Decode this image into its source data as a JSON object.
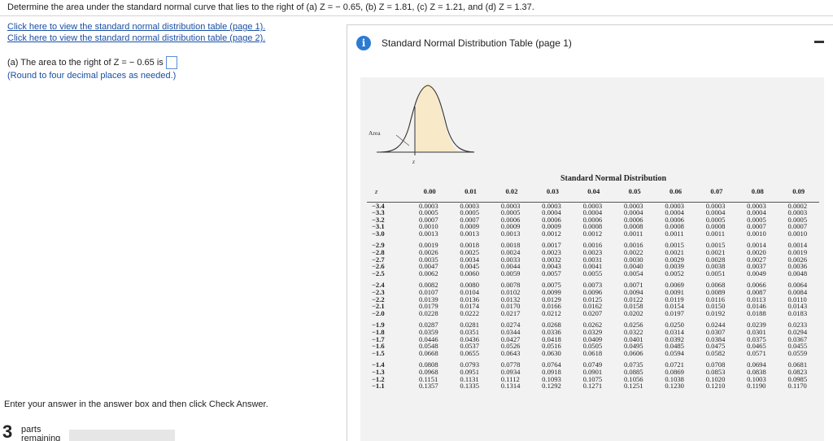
{
  "question": "Determine the area under the standard normal curve that lies to the right of (a) Z = − 0.65, (b) Z = 1.81, (c) Z = 1.21, and (d) Z = 1.37.",
  "links": {
    "page1": "Click here to view the standard normal distribution table (page 1).",
    "page2": "Click here to view the standard normal distribution table (page 2)."
  },
  "part_a": {
    "label": "(a) The area to the right of Z = − 0.65 is",
    "value": "",
    "note": "(Round to four decimal places as needed.)"
  },
  "footer": {
    "instruction": "Enter your answer in the answer box and then click Check Answer.",
    "parts_count": "3",
    "parts_label_1": "parts",
    "parts_label_2": "remaining",
    "progress_fraction": 0.0,
    "accent_color": "#5b8ed6"
  },
  "panel": {
    "title": "Standard Normal Distribution Table (page 1)",
    "icon": "info-icon",
    "curve_labels": {
      "area": "Area",
      "z": "z"
    },
    "table_title": "Standard Normal Distribution",
    "z_header": "z",
    "columns": [
      "0.00",
      "0.01",
      "0.02",
      "0.03",
      "0.04",
      "0.05",
      "0.06",
      "0.07",
      "0.08",
      "0.09"
    ],
    "groups": [
      [
        {
          "z": "−3.4",
          "v": [
            "0.0003",
            "0.0003",
            "0.0003",
            "0.0003",
            "0.0003",
            "0.0003",
            "0.0003",
            "0.0003",
            "0.0003",
            "0.0002"
          ]
        },
        {
          "z": "−3.3",
          "v": [
            "0.0005",
            "0.0005",
            "0.0005",
            "0.0004",
            "0.0004",
            "0.0004",
            "0.0004",
            "0.0004",
            "0.0004",
            "0.0003"
          ]
        },
        {
          "z": "−3.2",
          "v": [
            "0.0007",
            "0.0007",
            "0.0006",
            "0.0006",
            "0.0006",
            "0.0006",
            "0.0006",
            "0.0005",
            "0.0005",
            "0.0005"
          ]
        },
        {
          "z": "−3.1",
          "v": [
            "0.0010",
            "0.0009",
            "0.0009",
            "0.0009",
            "0.0008",
            "0.0008",
            "0.0008",
            "0.0008",
            "0.0007",
            "0.0007"
          ]
        },
        {
          "z": "−3.0",
          "v": [
            "0.0013",
            "0.0013",
            "0.0013",
            "0.0012",
            "0.0012",
            "0.0011",
            "0.0011",
            "0.0011",
            "0.0010",
            "0.0010"
          ]
        }
      ],
      [
        {
          "z": "−2.9",
          "v": [
            "0.0019",
            "0.0018",
            "0.0018",
            "0.0017",
            "0.0016",
            "0.0016",
            "0.0015",
            "0.0015",
            "0.0014",
            "0.0014"
          ]
        },
        {
          "z": "−2.8",
          "v": [
            "0.0026",
            "0.0025",
            "0.0024",
            "0.0023",
            "0.0023",
            "0.0022",
            "0.0021",
            "0.0021",
            "0.0020",
            "0.0019"
          ]
        },
        {
          "z": "−2.7",
          "v": [
            "0.0035",
            "0.0034",
            "0.0033",
            "0.0032",
            "0.0031",
            "0.0030",
            "0.0029",
            "0.0028",
            "0.0027",
            "0.0026"
          ]
        },
        {
          "z": "−2.6",
          "v": [
            "0.0047",
            "0.0045",
            "0.0044",
            "0.0043",
            "0.0041",
            "0.0040",
            "0.0039",
            "0.0038",
            "0.0037",
            "0.0036"
          ]
        },
        {
          "z": "−2.5",
          "v": [
            "0.0062",
            "0.0060",
            "0.0059",
            "0.0057",
            "0.0055",
            "0.0054",
            "0.0052",
            "0.0051",
            "0.0049",
            "0.0048"
          ]
        }
      ],
      [
        {
          "z": "−2.4",
          "v": [
            "0.0082",
            "0.0080",
            "0.0078",
            "0.0075",
            "0.0073",
            "0.0071",
            "0.0069",
            "0.0068",
            "0.0066",
            "0.0064"
          ]
        },
        {
          "z": "−2.3",
          "v": [
            "0.0107",
            "0.0104",
            "0.0102",
            "0.0099",
            "0.0096",
            "0.0094",
            "0.0091",
            "0.0089",
            "0.0087",
            "0.0084"
          ]
        },
        {
          "z": "−2.2",
          "v": [
            "0.0139",
            "0.0136",
            "0.0132",
            "0.0129",
            "0.0125",
            "0.0122",
            "0.0119",
            "0.0116",
            "0.0113",
            "0.0110"
          ]
        },
        {
          "z": "−2.1",
          "v": [
            "0.0179",
            "0.0174",
            "0.0170",
            "0.0166",
            "0.0162",
            "0.0158",
            "0.0154",
            "0.0150",
            "0.0146",
            "0.0143"
          ]
        },
        {
          "z": "−2.0",
          "v": [
            "0.0228",
            "0.0222",
            "0.0217",
            "0.0212",
            "0.0207",
            "0.0202",
            "0.0197",
            "0.0192",
            "0.0188",
            "0.0183"
          ]
        }
      ],
      [
        {
          "z": "−1.9",
          "v": [
            "0.0287",
            "0.0281",
            "0.0274",
            "0.0268",
            "0.0262",
            "0.0256",
            "0.0250",
            "0.0244",
            "0.0239",
            "0.0233"
          ]
        },
        {
          "z": "−1.8",
          "v": [
            "0.0359",
            "0.0351",
            "0.0344",
            "0.0336",
            "0.0329",
            "0.0322",
            "0.0314",
            "0.0307",
            "0.0301",
            "0.0294"
          ]
        },
        {
          "z": "−1.7",
          "v": [
            "0.0446",
            "0.0436",
            "0.0427",
            "0.0418",
            "0.0409",
            "0.0401",
            "0.0392",
            "0.0384",
            "0.0375",
            "0.0367"
          ]
        },
        {
          "z": "−1.6",
          "v": [
            "0.0548",
            "0.0537",
            "0.0526",
            "0.0516",
            "0.0505",
            "0.0495",
            "0.0485",
            "0.0475",
            "0.0465",
            "0.0455"
          ]
        },
        {
          "z": "−1.5",
          "v": [
            "0.0668",
            "0.0655",
            "0.0643",
            "0.0630",
            "0.0618",
            "0.0606",
            "0.0594",
            "0.0582",
            "0.0571",
            "0.0559"
          ]
        }
      ],
      [
        {
          "z": "−1.4",
          "v": [
            "0.0808",
            "0.0793",
            "0.0778",
            "0.0764",
            "0.0749",
            "0.0735",
            "0.0721",
            "0.0708",
            "0.0694",
            "0.0681"
          ]
        },
        {
          "z": "−1.3",
          "v": [
            "0.0968",
            "0.0951",
            "0.0934",
            "0.0918",
            "0.0901",
            "0.0885",
            "0.0869",
            "0.0853",
            "0.0838",
            "0.0823"
          ]
        },
        {
          "z": "−1.2",
          "v": [
            "0.1151",
            "0.1131",
            "0.1112",
            "0.1093",
            "0.1075",
            "0.1056",
            "0.1038",
            "0.1020",
            "0.1003",
            "0.0985"
          ]
        },
        {
          "z": "−1.1",
          "v": [
            "0.1357",
            "0.1335",
            "0.1314",
            "0.1292",
            "0.1271",
            "0.1251",
            "0.1230",
            "0.1210",
            "0.1190",
            "0.1170"
          ]
        }
      ]
    ]
  }
}
